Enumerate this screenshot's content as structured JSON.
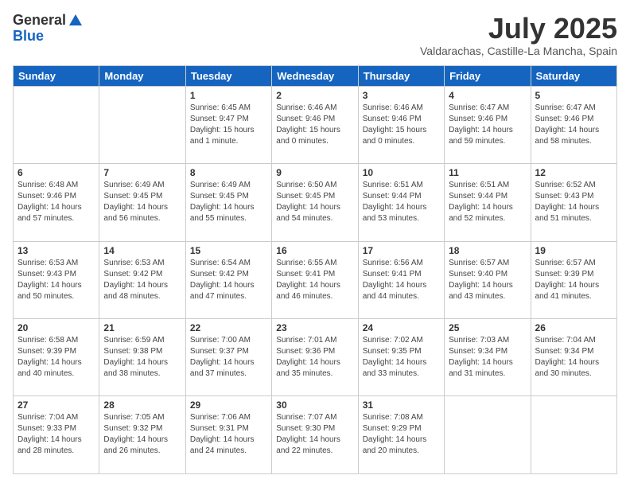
{
  "header": {
    "logo_general": "General",
    "logo_blue": "Blue",
    "month_title": "July 2025",
    "location": "Valdarachas, Castille-La Mancha, Spain"
  },
  "days_of_week": [
    "Sunday",
    "Monday",
    "Tuesday",
    "Wednesday",
    "Thursday",
    "Friday",
    "Saturday"
  ],
  "weeks": [
    [
      {
        "day": "",
        "detail": ""
      },
      {
        "day": "",
        "detail": ""
      },
      {
        "day": "1",
        "detail": "Sunrise: 6:45 AM\nSunset: 9:47 PM\nDaylight: 15 hours\nand 1 minute."
      },
      {
        "day": "2",
        "detail": "Sunrise: 6:46 AM\nSunset: 9:46 PM\nDaylight: 15 hours\nand 0 minutes."
      },
      {
        "day": "3",
        "detail": "Sunrise: 6:46 AM\nSunset: 9:46 PM\nDaylight: 15 hours\nand 0 minutes."
      },
      {
        "day": "4",
        "detail": "Sunrise: 6:47 AM\nSunset: 9:46 PM\nDaylight: 14 hours\nand 59 minutes."
      },
      {
        "day": "5",
        "detail": "Sunrise: 6:47 AM\nSunset: 9:46 PM\nDaylight: 14 hours\nand 58 minutes."
      }
    ],
    [
      {
        "day": "6",
        "detail": "Sunrise: 6:48 AM\nSunset: 9:46 PM\nDaylight: 14 hours\nand 57 minutes."
      },
      {
        "day": "7",
        "detail": "Sunrise: 6:49 AM\nSunset: 9:45 PM\nDaylight: 14 hours\nand 56 minutes."
      },
      {
        "day": "8",
        "detail": "Sunrise: 6:49 AM\nSunset: 9:45 PM\nDaylight: 14 hours\nand 55 minutes."
      },
      {
        "day": "9",
        "detail": "Sunrise: 6:50 AM\nSunset: 9:45 PM\nDaylight: 14 hours\nand 54 minutes."
      },
      {
        "day": "10",
        "detail": "Sunrise: 6:51 AM\nSunset: 9:44 PM\nDaylight: 14 hours\nand 53 minutes."
      },
      {
        "day": "11",
        "detail": "Sunrise: 6:51 AM\nSunset: 9:44 PM\nDaylight: 14 hours\nand 52 minutes."
      },
      {
        "day": "12",
        "detail": "Sunrise: 6:52 AM\nSunset: 9:43 PM\nDaylight: 14 hours\nand 51 minutes."
      }
    ],
    [
      {
        "day": "13",
        "detail": "Sunrise: 6:53 AM\nSunset: 9:43 PM\nDaylight: 14 hours\nand 50 minutes."
      },
      {
        "day": "14",
        "detail": "Sunrise: 6:53 AM\nSunset: 9:42 PM\nDaylight: 14 hours\nand 48 minutes."
      },
      {
        "day": "15",
        "detail": "Sunrise: 6:54 AM\nSunset: 9:42 PM\nDaylight: 14 hours\nand 47 minutes."
      },
      {
        "day": "16",
        "detail": "Sunrise: 6:55 AM\nSunset: 9:41 PM\nDaylight: 14 hours\nand 46 minutes."
      },
      {
        "day": "17",
        "detail": "Sunrise: 6:56 AM\nSunset: 9:41 PM\nDaylight: 14 hours\nand 44 minutes."
      },
      {
        "day": "18",
        "detail": "Sunrise: 6:57 AM\nSunset: 9:40 PM\nDaylight: 14 hours\nand 43 minutes."
      },
      {
        "day": "19",
        "detail": "Sunrise: 6:57 AM\nSunset: 9:39 PM\nDaylight: 14 hours\nand 41 minutes."
      }
    ],
    [
      {
        "day": "20",
        "detail": "Sunrise: 6:58 AM\nSunset: 9:39 PM\nDaylight: 14 hours\nand 40 minutes."
      },
      {
        "day": "21",
        "detail": "Sunrise: 6:59 AM\nSunset: 9:38 PM\nDaylight: 14 hours\nand 38 minutes."
      },
      {
        "day": "22",
        "detail": "Sunrise: 7:00 AM\nSunset: 9:37 PM\nDaylight: 14 hours\nand 37 minutes."
      },
      {
        "day": "23",
        "detail": "Sunrise: 7:01 AM\nSunset: 9:36 PM\nDaylight: 14 hours\nand 35 minutes."
      },
      {
        "day": "24",
        "detail": "Sunrise: 7:02 AM\nSunset: 9:35 PM\nDaylight: 14 hours\nand 33 minutes."
      },
      {
        "day": "25",
        "detail": "Sunrise: 7:03 AM\nSunset: 9:34 PM\nDaylight: 14 hours\nand 31 minutes."
      },
      {
        "day": "26",
        "detail": "Sunrise: 7:04 AM\nSunset: 9:34 PM\nDaylight: 14 hours\nand 30 minutes."
      }
    ],
    [
      {
        "day": "27",
        "detail": "Sunrise: 7:04 AM\nSunset: 9:33 PM\nDaylight: 14 hours\nand 28 minutes."
      },
      {
        "day": "28",
        "detail": "Sunrise: 7:05 AM\nSunset: 9:32 PM\nDaylight: 14 hours\nand 26 minutes."
      },
      {
        "day": "29",
        "detail": "Sunrise: 7:06 AM\nSunset: 9:31 PM\nDaylight: 14 hours\nand 24 minutes."
      },
      {
        "day": "30",
        "detail": "Sunrise: 7:07 AM\nSunset: 9:30 PM\nDaylight: 14 hours\nand 22 minutes."
      },
      {
        "day": "31",
        "detail": "Sunrise: 7:08 AM\nSunset: 9:29 PM\nDaylight: 14 hours\nand 20 minutes."
      },
      {
        "day": "",
        "detail": ""
      },
      {
        "day": "",
        "detail": ""
      }
    ]
  ]
}
